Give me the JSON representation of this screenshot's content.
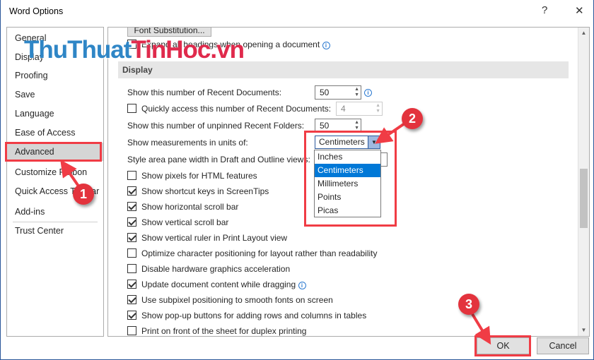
{
  "window": {
    "title": "Word Options",
    "help": "?",
    "close": "✕"
  },
  "sidebar": {
    "items": [
      {
        "label": "General"
      },
      {
        "label": "Display"
      },
      {
        "label": "Proofing"
      },
      {
        "label": "Save"
      },
      {
        "label": "Language"
      },
      {
        "label": "Ease of Access"
      },
      {
        "label": "Advanced",
        "selected": true
      },
      {
        "label": "Customize Ribbon"
      },
      {
        "label": "Quick Access Toolbar"
      },
      {
        "label": "Add-ins"
      },
      {
        "label": "Trust Center"
      }
    ]
  },
  "main": {
    "font_substitution": "Font Substitution...",
    "expand_headings": {
      "label": "Expand all headings when opening a document",
      "checked": false
    },
    "section": "Display",
    "recent_docs": {
      "label": "Show this number of Recent Documents:",
      "value": "50"
    },
    "quick_access": {
      "label": "Quickly access this number of Recent Documents:",
      "value": "4",
      "checked": false
    },
    "recent_folders": {
      "label": "Show this number of unpinned Recent Folders:",
      "value": "50"
    },
    "measurements": {
      "label": "Show measurements in units of:",
      "value": "Centimeters",
      "options": [
        "Inches",
        "Centimeters",
        "Millimeters",
        "Points",
        "Picas"
      ],
      "selected": "Centimeters"
    },
    "style_area": {
      "label": "Style area pane width in Draft and Outline views:"
    },
    "checkboxes": [
      {
        "label": "Show pixels for HTML features",
        "checked": false
      },
      {
        "label": "Show shortcut keys in ScreenTips",
        "checked": true
      },
      {
        "label": "Show horizontal scroll bar",
        "checked": true
      },
      {
        "label": "Show vertical scroll bar",
        "checked": true
      },
      {
        "label": "Show vertical ruler in Print Layout view",
        "checked": true
      },
      {
        "label": "Optimize character positioning for layout rather than readability",
        "checked": false
      },
      {
        "label": "Disable hardware graphics acceleration",
        "checked": false
      },
      {
        "label": "Update document content while dragging",
        "checked": true,
        "info": true
      },
      {
        "label": "Use subpixel positioning to smooth fonts on screen",
        "checked": true
      },
      {
        "label": "Show pop-up buttons for adding rows and columns in tables",
        "checked": true
      },
      {
        "label": "Print on front of the sheet for duplex printing",
        "checked": false
      }
    ]
  },
  "footer": {
    "ok": "OK",
    "cancel": "Cancel"
  },
  "annotations": {
    "steps": [
      "1",
      "2",
      "3"
    ],
    "color": "#f03c45"
  },
  "watermark": {
    "part1": "ThuThuat",
    "part2": "TinHoc.vn"
  }
}
